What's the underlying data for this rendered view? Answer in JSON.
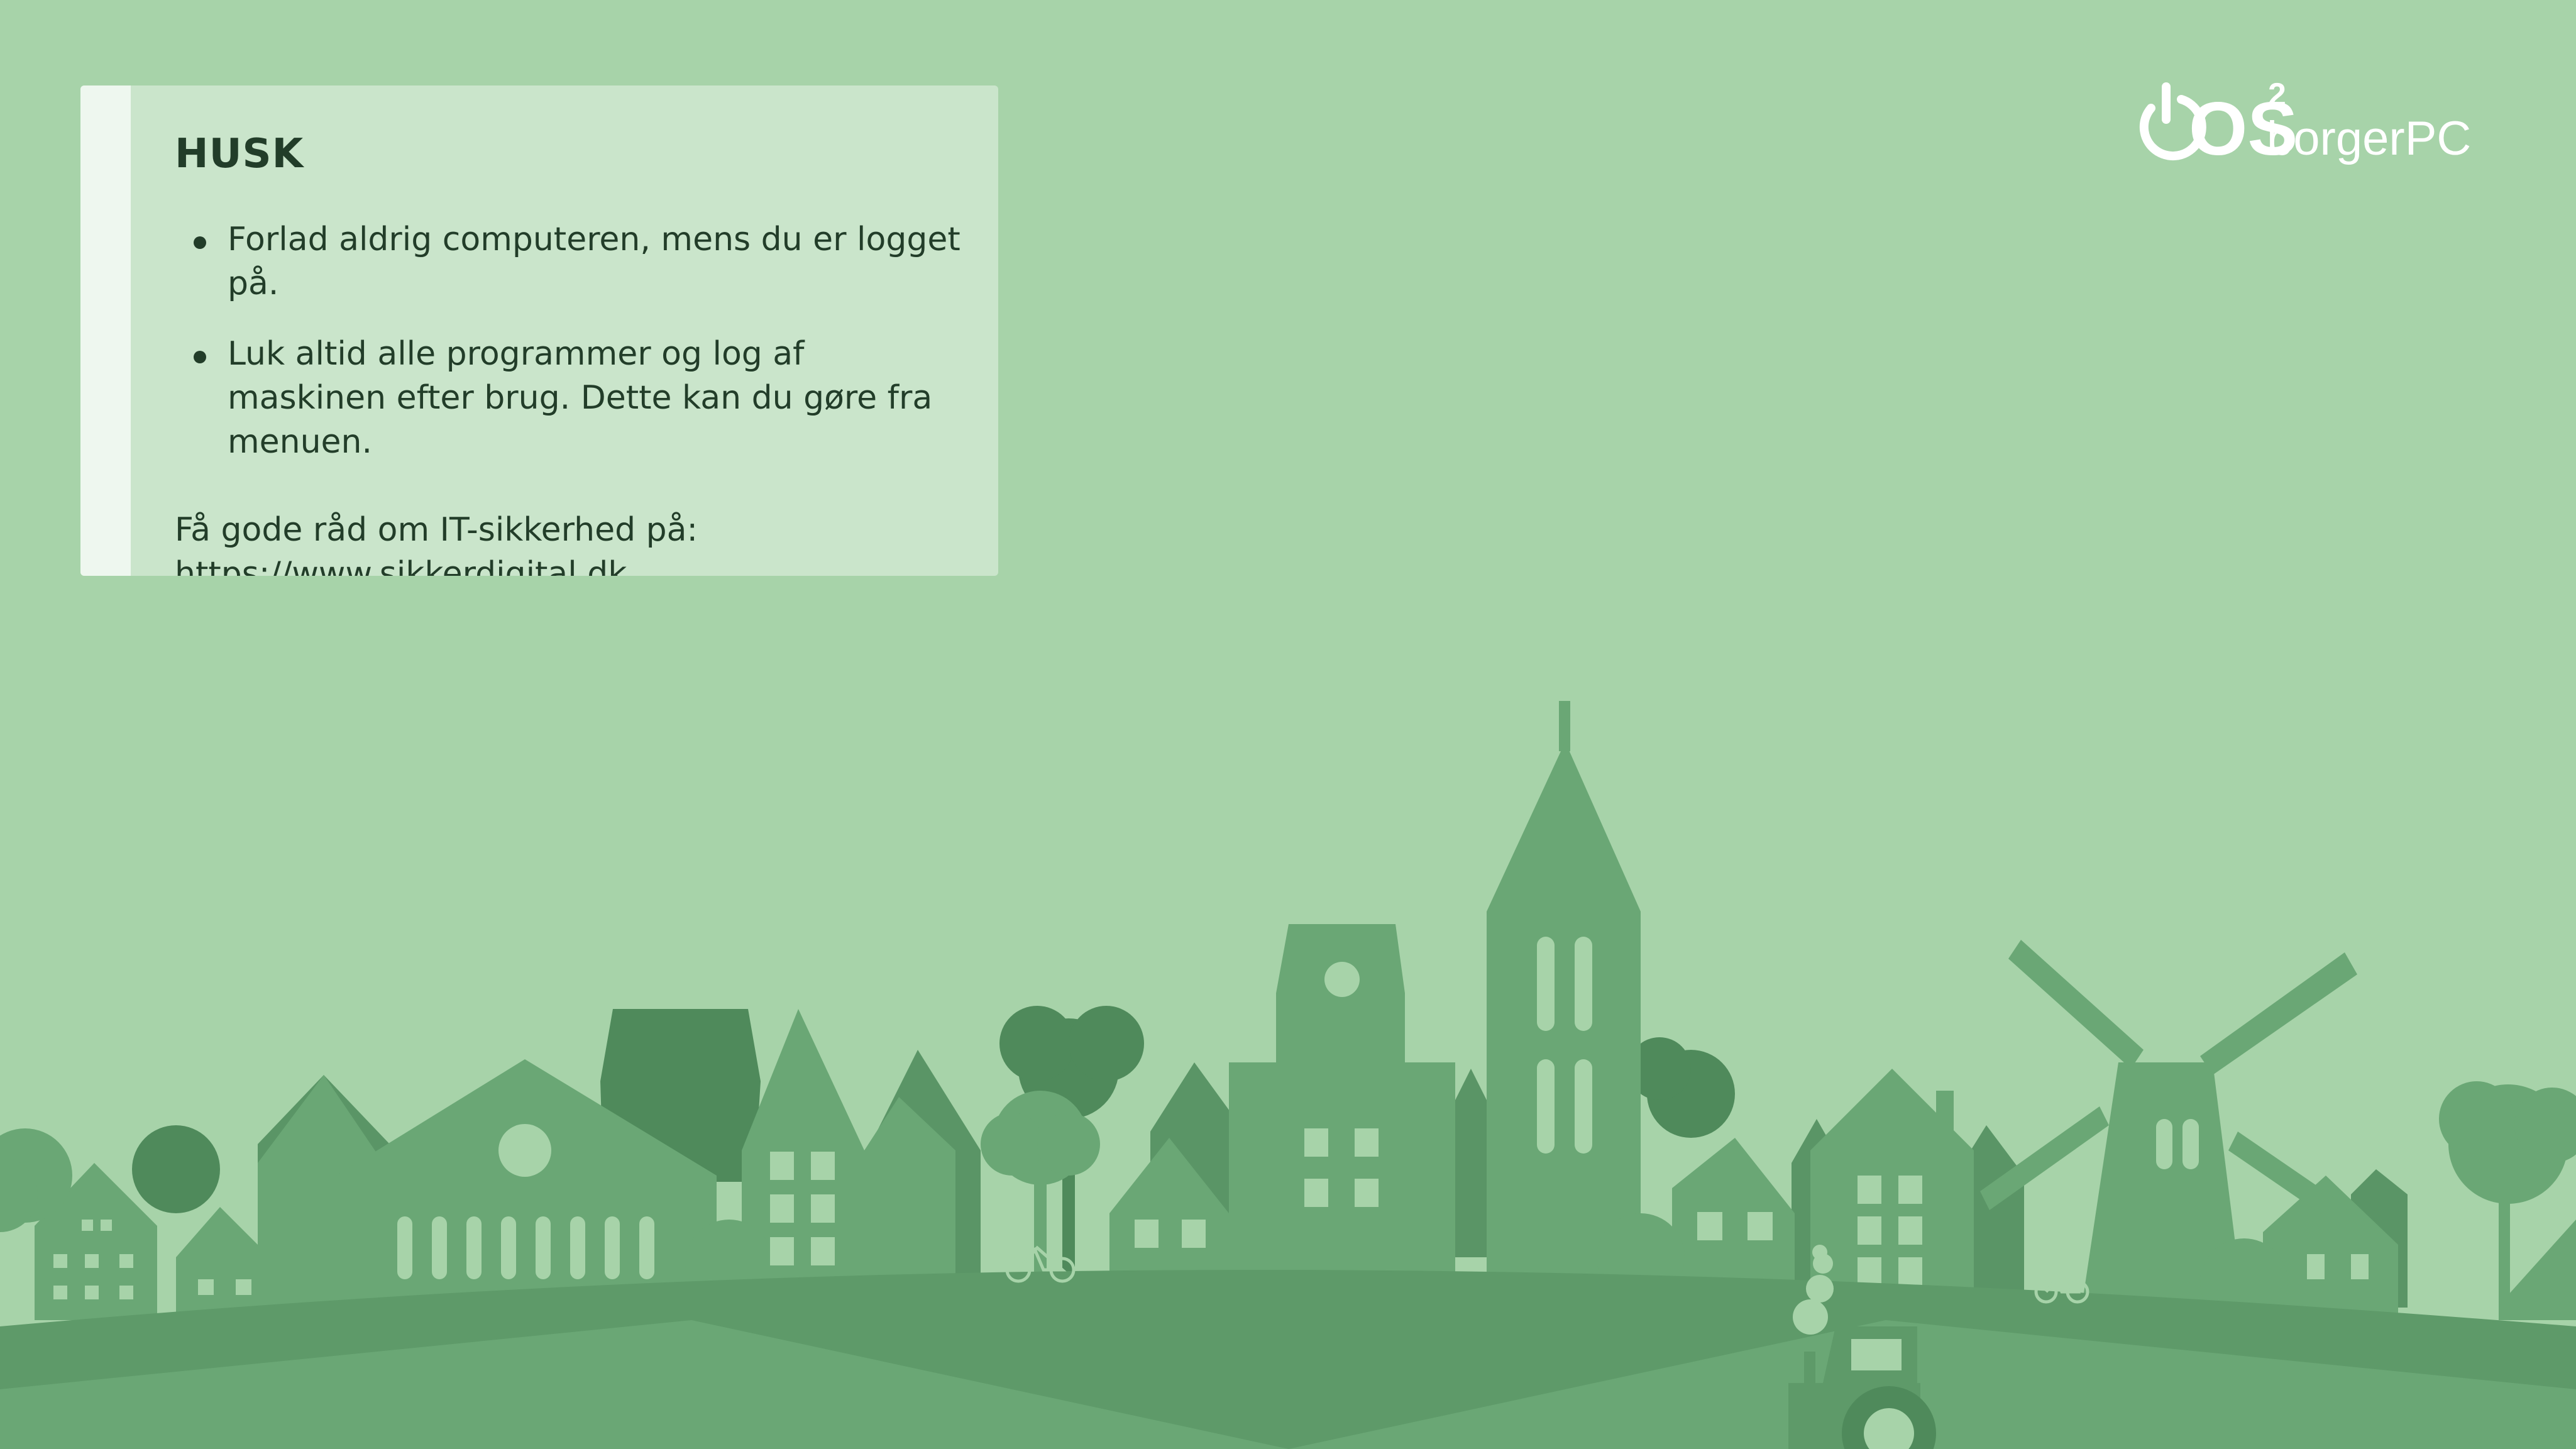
{
  "reminder": {
    "title": "HUSK",
    "items": [
      "Forlad aldrig computeren, mens du er logget på.",
      "Luk altid alle programmer og log af maskinen efter brug. Dette kan du gøre fra menuen."
    ],
    "tip_text": "Få gode råd om IT-sikkerhed på:",
    "tip_link": "https://www.sikkerdigital.dk"
  },
  "logo": {
    "mark": "OS",
    "superscript": "2",
    "product": "borgerPC",
    "icon": "power-icon"
  },
  "colors": {
    "background": "#a7d3a9",
    "card": "#cae5cb",
    "card_accent": "#eef7ef",
    "text": "#223d29",
    "skyline_light": "#6aa775",
    "skyline_mid": "#5e9a69",
    "skyline_dark": "#4d875b"
  }
}
